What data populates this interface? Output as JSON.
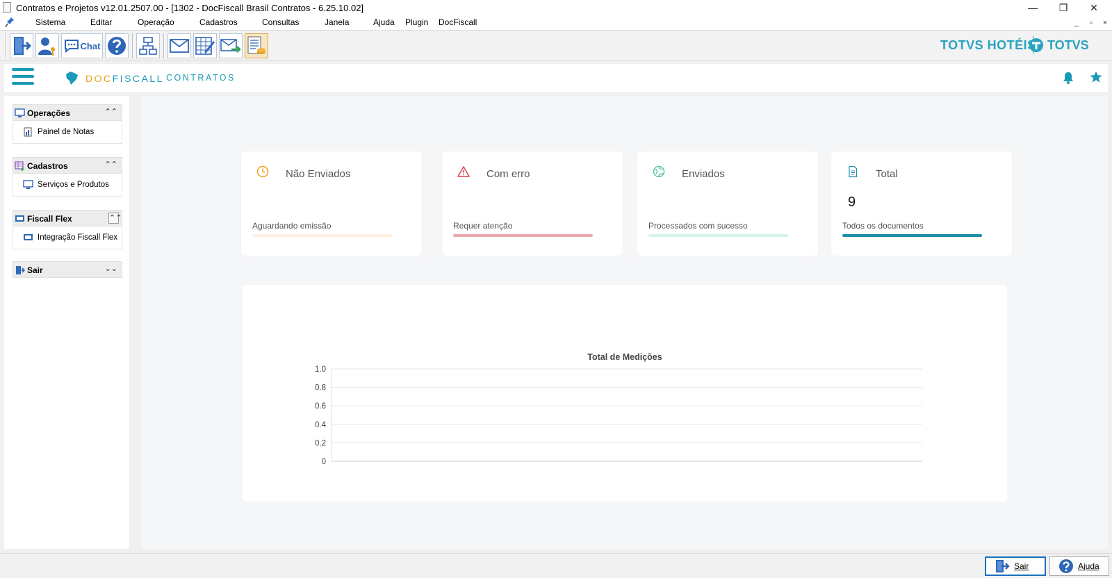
{
  "window": {
    "title": "Contratos e Projetos v12.01.2507.00 - [1302 - DocFiscall Brasil Contratos - 6.25.10.02]",
    "minimize_glyph": "—",
    "restore_glyph": "❐",
    "close_glyph": "✕"
  },
  "menu": {
    "items": [
      "Sistema",
      "Editar",
      "Operação",
      "Cadastros",
      "Consultas",
      "Janela",
      "Ajuda",
      "Plugin",
      "DocFiscall"
    ],
    "mdi": {
      "minimize": "_",
      "restore": "▫",
      "close": "×"
    }
  },
  "toolbar": {
    "buttons": [
      "exit-door-icon",
      "user-key-icon",
      "chat-icon",
      "help-icon",
      "structure-icon",
      "mail-icon",
      "edit-grid-icon",
      "send-mail-icon",
      "report-coins-icon"
    ],
    "chat_label": "Chat",
    "brand_hoteis": "TOTVS HOTÉIS",
    "brand_totvs": "TOTVS"
  },
  "header": {
    "logo_doc": "DOC",
    "logo_fiscall": "FISCALL",
    "logo_sub": "CONTRATOS",
    "accent": "#1b9ab8",
    "logo_orange": "#f0a020"
  },
  "sidebar": {
    "groups": [
      {
        "title": "Operações",
        "item": "Painel de Notas",
        "chevron": "⌃⌃"
      },
      {
        "title": "Cadastros",
        "item": "Serviços e Produtos",
        "chevron": "⌃⌃"
      },
      {
        "title": "Fiscall Flex",
        "item": "Integração Fiscall Flex",
        "chevron": "⌃⌃"
      },
      {
        "title": "Sair",
        "item": "",
        "chevron": "⌄⌄"
      }
    ]
  },
  "cards": [
    {
      "title": "Não Enviados",
      "value": "",
      "subtitle": "Aguardando emissão",
      "bar_color": "#fdf0e3",
      "icon": "clock-icon"
    },
    {
      "title": "Com erro",
      "value": "",
      "subtitle": "Requer atenção",
      "bar_color": "#eaaaae",
      "icon": "warning-icon"
    },
    {
      "title": "Enviados",
      "value": "",
      "subtitle": "Processados com sucesso",
      "bar_color": "#d6f3ea",
      "icon": "globe-check-icon"
    },
    {
      "title": "Total",
      "value": "9",
      "subtitle": "Todos os documentos",
      "bar_color": "#1e8ea8",
      "icon": "document-icon"
    }
  ],
  "chart_data": {
    "type": "bar",
    "title": "Total de Medições",
    "categories": [],
    "series": [],
    "xlabel": "",
    "ylabel": "",
    "ylim": [
      0,
      1.0
    ],
    "yticks": [
      "0",
      "0.2",
      "0.4",
      "0.6",
      "0.8",
      "1.0"
    ],
    "grid": true
  },
  "statusbar": {
    "sair": "Sair",
    "ajuda": "Ajuda"
  }
}
